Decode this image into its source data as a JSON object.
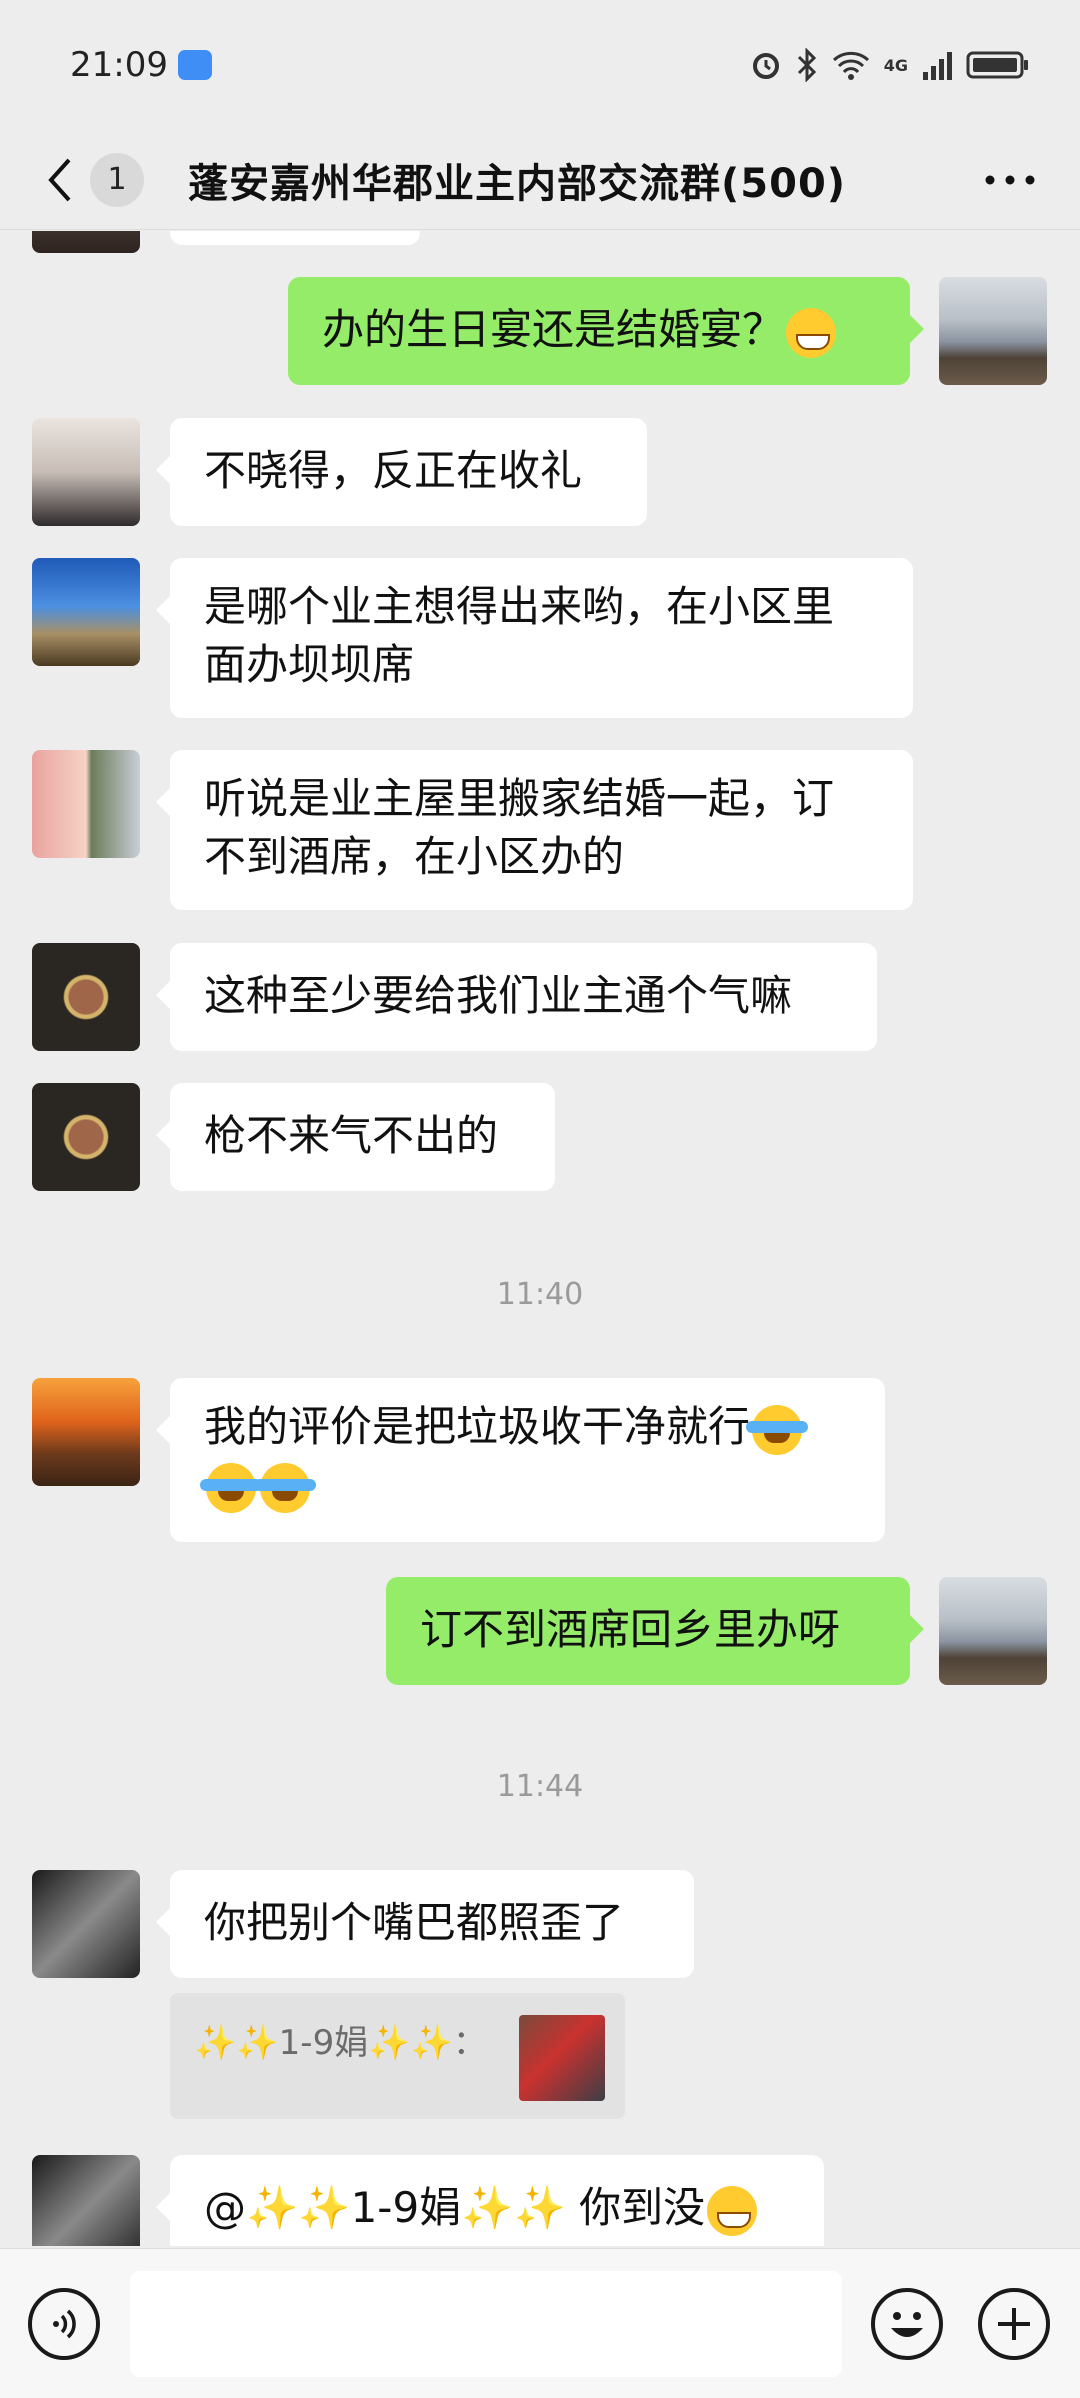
{
  "status_bar": {
    "time": "21:09",
    "network": "4G",
    "icons": [
      "app-notification-icon",
      "alarm-icon",
      "bluetooth-icon",
      "wifi-icon",
      "cellular-signal-icon",
      "battery-icon"
    ]
  },
  "header": {
    "unread_count": "1",
    "title": "蓬安嘉州华郡业主内部交流群(500)",
    "back_icon": "chevron-left-icon",
    "more_icon": "more-dots-icon"
  },
  "messages": [
    {
      "side": "right",
      "text": "办的生日宴还是结婚宴？",
      "emoji": "grin"
    },
    {
      "side": "left",
      "text": "不晓得，反正在收礼"
    },
    {
      "side": "left",
      "lines": [
        "是哪个业主想得出来哟，在小区里",
        "面办坝坝席"
      ]
    },
    {
      "side": "left",
      "lines": [
        "听说是业主屋里搬家结婚一起，订",
        "不到酒席，在小区办的"
      ]
    },
    {
      "side": "left",
      "text": "这种至少要给我们业主通个气嘛"
    },
    {
      "side": "left",
      "text": "枪不来气不出的"
    },
    {
      "side": "left",
      "lines": [
        "我的评价是把垃圾收干净就行",
        ""
      ],
      "emoji": "tears"
    },
    {
      "side": "right",
      "text": "订不到酒席回乡里办呀"
    },
    {
      "side": "left",
      "text": "你把别个嘴巴都照歪了"
    },
    {
      "side": "left",
      "text": "@✨✨1-9娟✨✨ 你到没",
      "emoji": "grin"
    }
  ],
  "timestamps": [
    "11:40",
    "11:44"
  ],
  "quote": {
    "text": "✨✨1-9娟✨✨："
  },
  "input_bar": {
    "placeholder": "",
    "icons": [
      "voice-icon",
      "emoji-icon",
      "plus-icon"
    ]
  },
  "colors": {
    "background": "#ededed",
    "bubble_self": "#95ec69",
    "bubble_other": "#ffffff",
    "timestamp": "#9a9a9a"
  }
}
